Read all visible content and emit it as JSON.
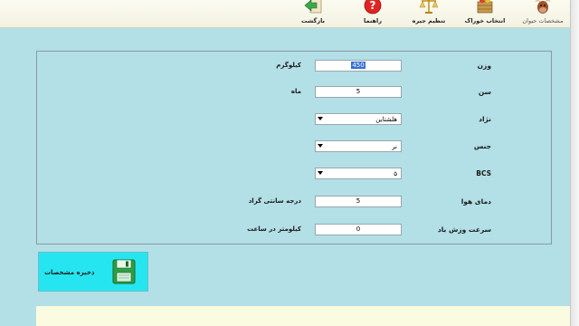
{
  "toolbar": {
    "buttons": [
      {
        "id": "animal",
        "label": "مشخصات حیوان",
        "icon": "cow-icon"
      },
      {
        "id": "feed",
        "label": "انتخاب خوراک",
        "icon": "feed-crate-icon"
      },
      {
        "id": "ration",
        "label": "تنظیم جیره",
        "icon": "scale-icon"
      },
      {
        "id": "help",
        "label": "راهنما",
        "icon": "help-icon"
      },
      {
        "id": "back",
        "label": "بازگشت",
        "icon": "back-arrow-icon"
      }
    ]
  },
  "form": {
    "weight": {
      "label": "وزن",
      "value": "450",
      "unit": "کیلوگرم"
    },
    "age": {
      "label": "سن",
      "value": "5",
      "unit": "ماه"
    },
    "breed": {
      "label": "نژاد",
      "value": "هلشتاین"
    },
    "sex": {
      "label": "جنس",
      "value": "نر"
    },
    "bcs": {
      "label": "BCS",
      "value": "۵"
    },
    "temperature": {
      "label": "دمای هوا",
      "value": "5",
      "unit": "درجه سانتی گراد"
    },
    "wind": {
      "label": "سرعت وزش باد",
      "value": "0",
      "unit": "کیلومتر در ساعت"
    }
  },
  "save": {
    "label": "ذخیره مشخصات",
    "icon": "floppy-disk-icon"
  },
  "colors": {
    "background": "#b3dfe6",
    "save_button": "#25e6f0",
    "toolbar": "#f7f6e8",
    "bottom_panel": "#fbfbe2"
  }
}
